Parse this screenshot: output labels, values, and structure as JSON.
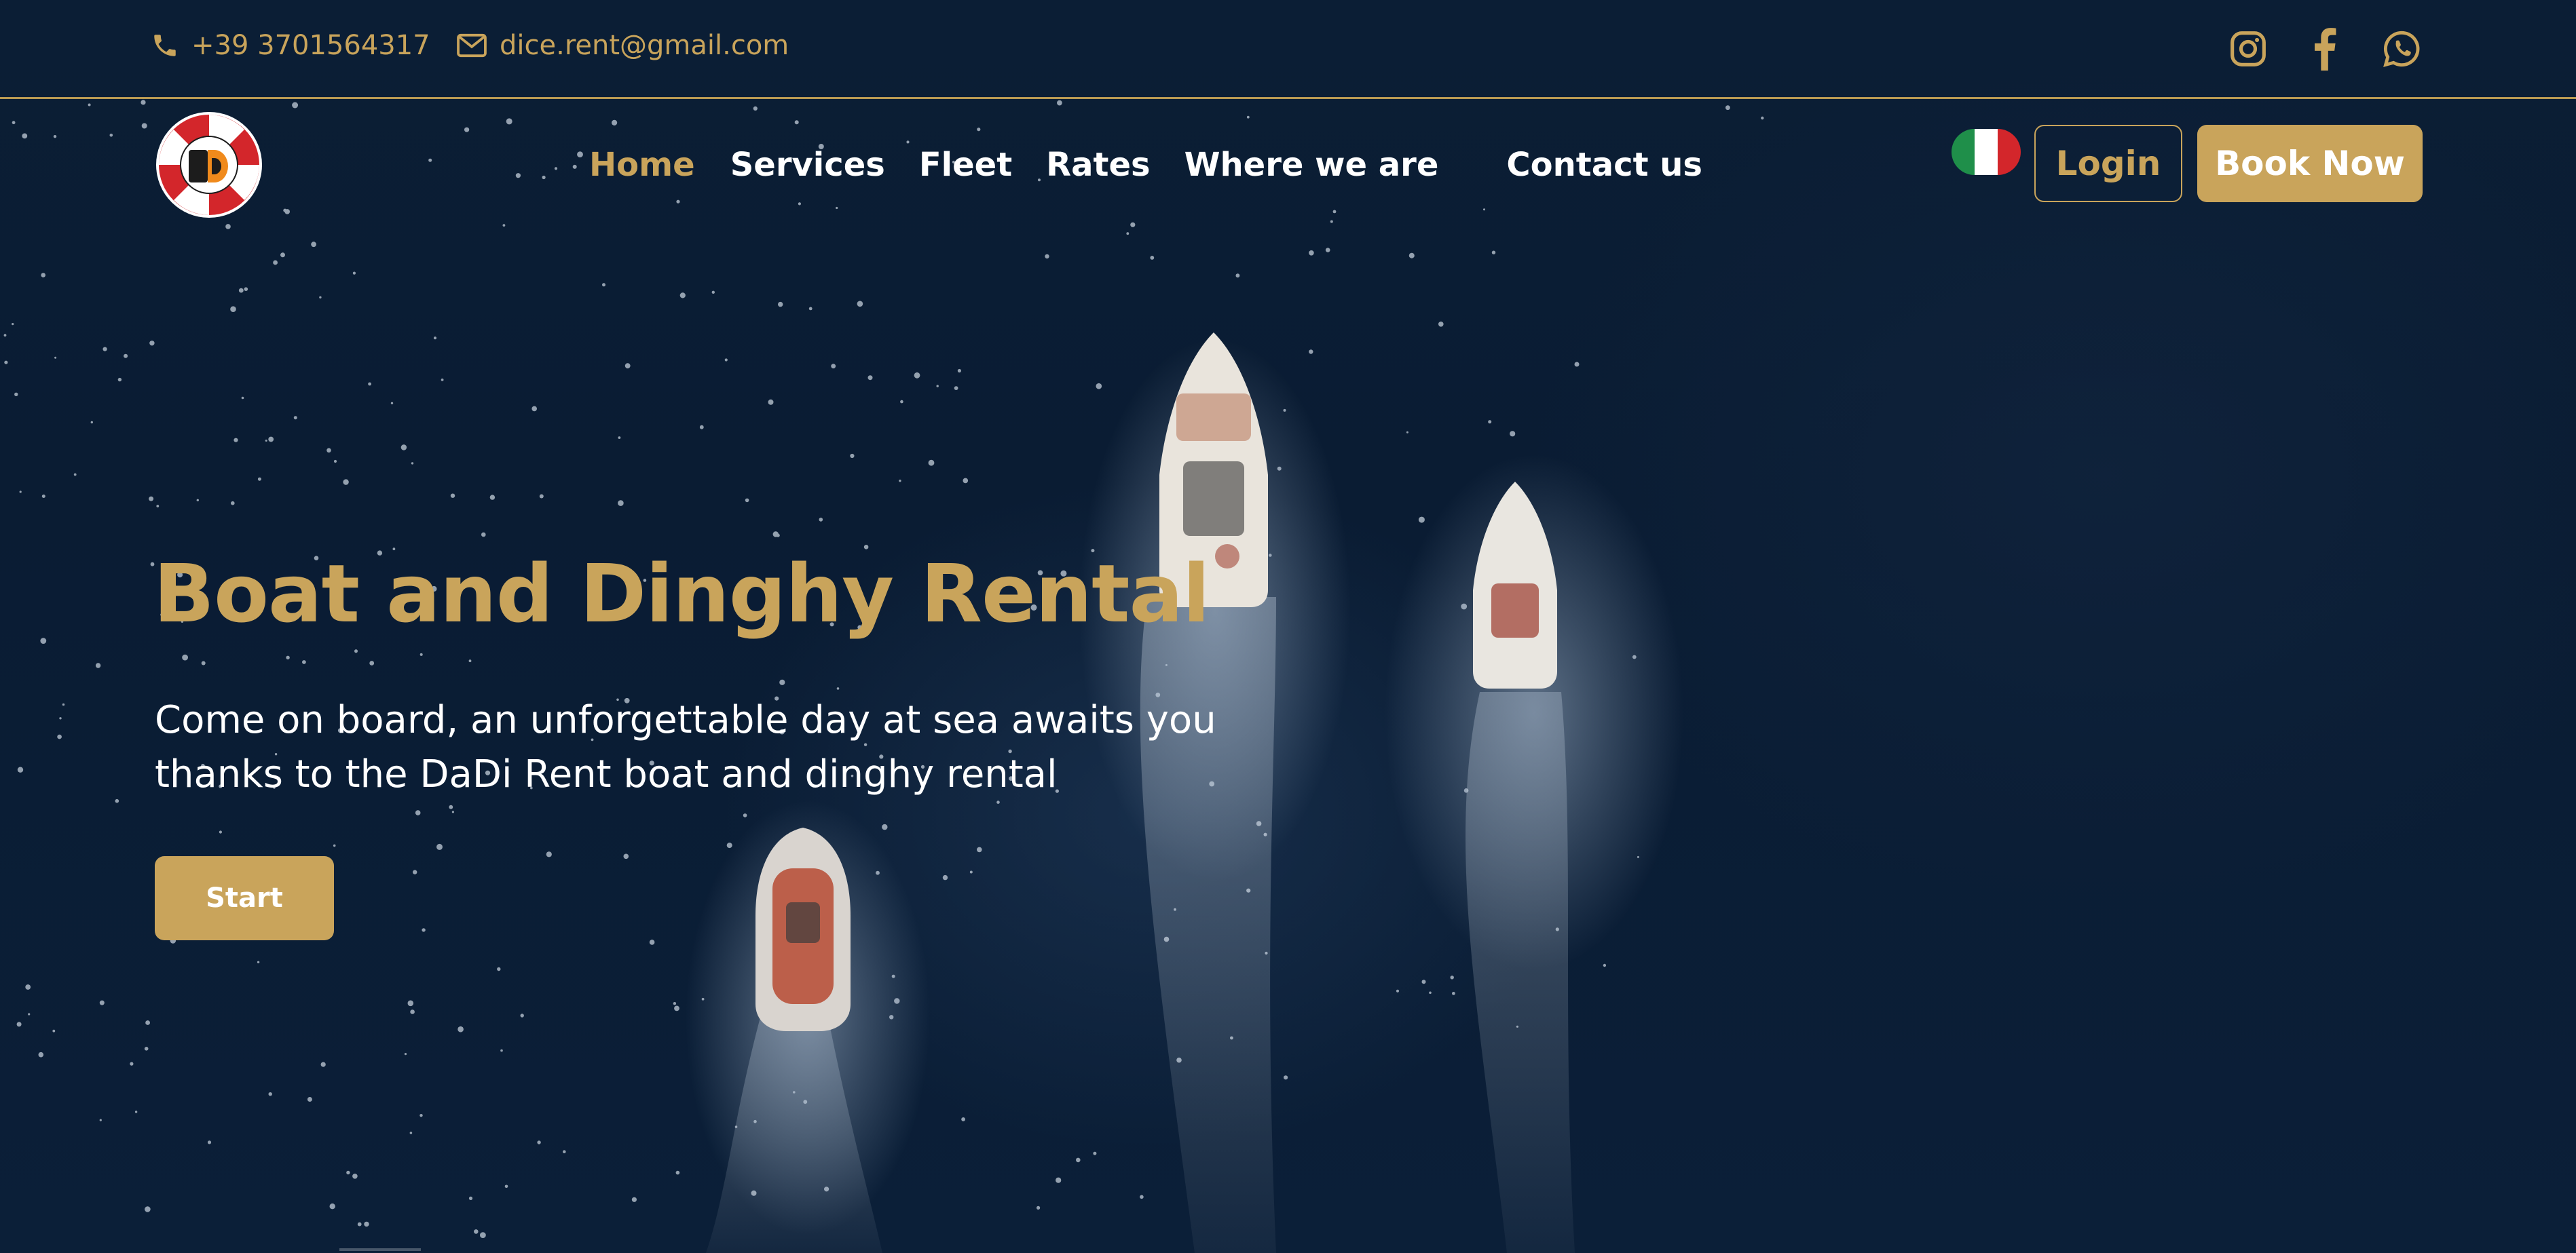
{
  "topbar": {
    "phone": "+39 3701564317",
    "email": "dice.rent@gmail.com",
    "phone_icon": "phone-icon",
    "email_icon": "envelope-icon",
    "social": [
      "instagram-icon",
      "facebook-icon",
      "whatsapp-icon"
    ]
  },
  "nav": {
    "items": [
      {
        "label": "Home",
        "active": true
      },
      {
        "label": "Services"
      },
      {
        "label": "Fleet"
      },
      {
        "label": "Rates"
      },
      {
        "label": "Where we are"
      },
      {
        "label": "Contact us"
      }
    ],
    "language_flag": "italy-flag-icon",
    "login_label": "Login",
    "book_label": "Book Now"
  },
  "hero": {
    "title": "Boat and Dinghy Rental",
    "subtitle_line1": "Come on board, an unforgettable day at sea awaits you",
    "subtitle_line2": "thanks to the DaDi Rent boat and dinghy rental",
    "cta_label": "Start"
  },
  "colors": {
    "accent": "#c9a45b",
    "background": "#0b1f36",
    "text": "#ffffff"
  }
}
